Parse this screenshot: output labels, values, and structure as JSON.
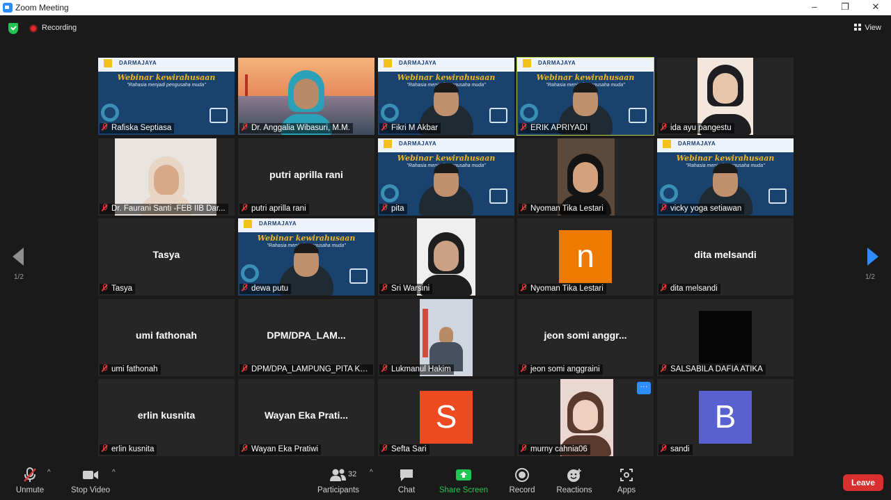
{
  "window": {
    "title": "Zoom Meeting",
    "minimize": "–",
    "restore": "❐",
    "close": "✕"
  },
  "topbar": {
    "recording_label": "Recording",
    "view_label": "View"
  },
  "pagination": {
    "left": "1/2",
    "right": "1/2"
  },
  "participants_grid": [
    {
      "name": "Rafiska Septiasa",
      "type": "banner"
    },
    {
      "name": "Dr. Anggalia Wibasuri, M.M.",
      "type": "photo"
    },
    {
      "name": "Fikri M Akbar",
      "type": "banner"
    },
    {
      "name": "ERIK APRIYADI",
      "type": "banner",
      "active": true
    },
    {
      "name": "ida ayu pangestu",
      "type": "photo"
    },
    {
      "name": "Dr. Faurani Santi -FEB IIB Dar...",
      "type": "photo"
    },
    {
      "name": "putri aprilla rani",
      "type": "name",
      "display": "putri aprilla rani"
    },
    {
      "name": "pita",
      "type": "banner"
    },
    {
      "name": "Nyoman Tika Lestari",
      "type": "photo"
    },
    {
      "name": "vicky yoga setiawan",
      "type": "banner"
    },
    {
      "name": "Tasya",
      "type": "name",
      "display": "Tasya"
    },
    {
      "name": "dewa putu",
      "type": "banner"
    },
    {
      "name": "Sri Warsini",
      "type": "photo"
    },
    {
      "name": "Nyoman Tika Lestari",
      "type": "avatar",
      "letter": "n",
      "color": "#ef7a00"
    },
    {
      "name": "dita melsandi",
      "type": "name",
      "display": "dita melsandi"
    },
    {
      "name": "umi fathonah",
      "type": "name",
      "display": "umi fathonah"
    },
    {
      "name": "DPM/DPA_LAMPUNG_PITA KH...",
      "type": "name",
      "display": "DPM/DPA_LAM..."
    },
    {
      "name": "Lukmanul Hakim",
      "type": "photo"
    },
    {
      "name": "jeon somi anggraini",
      "type": "name",
      "display": "jeon somi anggr..."
    },
    {
      "name": "SALSABILA DAFIA ATIKA",
      "type": "dark"
    },
    {
      "name": "erlin kusnita",
      "type": "name",
      "display": "erlin kusnita"
    },
    {
      "name": "Wayan Eka Pratiwi",
      "type": "name",
      "display": "Wayan Eka Prati..."
    },
    {
      "name": "Sefta Sari",
      "type": "avatar",
      "letter": "S",
      "color": "#ee4a21"
    },
    {
      "name": "murny cahnia06",
      "type": "photo",
      "more": "···"
    },
    {
      "name": "sandi",
      "type": "avatar",
      "letter": "B",
      "color": "#5861cf"
    }
  ],
  "banner": {
    "org": "DARMAJAYA",
    "title": "Webinar kewirahusaan",
    "subtitle": "\"Rahasia menjadi pengusaha muda\""
  },
  "toolbar": {
    "unmute": "Unmute",
    "stop_video": "Stop Video",
    "participants": "Participants",
    "participants_count": "32",
    "chat": "Chat",
    "share_screen": "Share Screen",
    "record": "Record",
    "reactions": "Reactions",
    "apps": "Apps",
    "leave": "Leave"
  },
  "colors": {
    "accent": "#2d8cff",
    "share_green": "#23c552",
    "leave_red": "#d92f2f",
    "active_speaker": "#b8d54a"
  }
}
